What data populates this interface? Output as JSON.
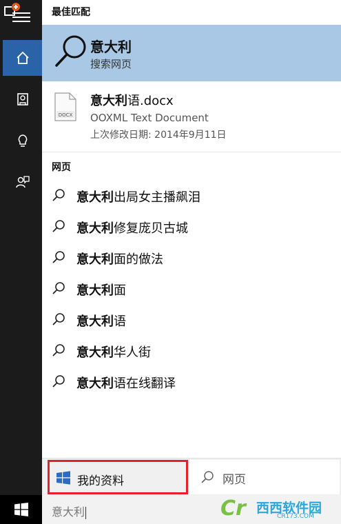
{
  "rail": {
    "icons": [
      "menu-icon",
      "home-icon",
      "notebook-icon",
      "reminder-icon",
      "feedback-icon",
      "windows-start-icon"
    ]
  },
  "best_match": {
    "heading": "最佳匹配",
    "title": "意大利",
    "subtitle": "搜索网页"
  },
  "document": {
    "name_bold": "意大利",
    "name_rest": "语.docx",
    "type": "OOXML Text Document",
    "modified": "上次修改日期: 2014年9月11日",
    "icon_label": "DOCX"
  },
  "web": {
    "heading": "网页",
    "items": [
      {
        "bold": "意大利",
        "rest": "出局女主播飙泪"
      },
      {
        "bold": "意大利",
        "rest": "修复庞贝古城"
      },
      {
        "bold": "意大利",
        "rest": "面的做法"
      },
      {
        "bold": "意大利",
        "rest": "面"
      },
      {
        "bold": "意大利",
        "rest": "语"
      },
      {
        "bold": "意大利",
        "rest": "华人街"
      },
      {
        "bold": "意大利",
        "rest": "语在线翻译"
      }
    ]
  },
  "bottom": {
    "my_info": "我的资料",
    "web_tab": "网页"
  },
  "search": {
    "query": "意大利"
  },
  "watermark": {
    "brand": "西西软件园",
    "url": "CR173.COM"
  },
  "colors": {
    "rail": "#1b1b1b",
    "home_active": "#2b63a8",
    "best_match_bg": "#a9c8e6",
    "highlight_border": "#e5202a"
  }
}
